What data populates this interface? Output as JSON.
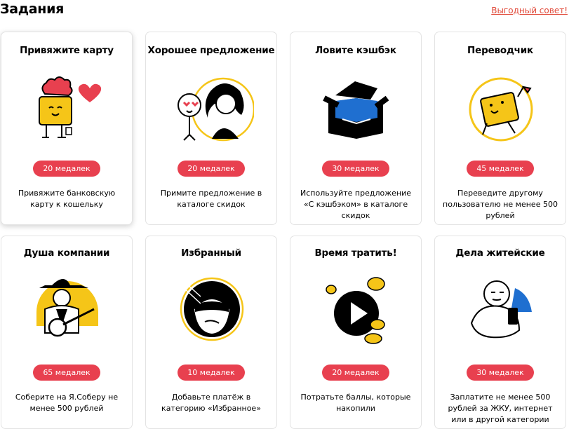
{
  "header": {
    "title": "Задания",
    "tip_link": "Выгодный совет!"
  },
  "colors": {
    "accent": "#e8404f",
    "yellow": "#f5c518",
    "link": "#e14a3a",
    "blue": "#1f6fd0"
  },
  "tasks": [
    {
      "title": "Привяжите карту",
      "badge": "20 медалек",
      "desc": "Привяжите банковскую карту к кошельку",
      "icon": "card-character-icon"
    },
    {
      "title": "Хорошее предложение",
      "badge": "20 медалек",
      "desc": "Примите предложение в каталоге скидок",
      "icon": "couple-icon"
    },
    {
      "title": "Ловите кэшбэк",
      "badge": "30 медалек",
      "desc": "Используйте предложение «С кэшбэком» в каталоге скидок",
      "icon": "open-box-icon"
    },
    {
      "title": "Переводчик",
      "badge": "45 медалек",
      "desc": "Переведите другому пользователю не менее 500 рублей",
      "icon": "running-card-icon"
    },
    {
      "title": "Душа компании",
      "badge": "65 медалек",
      "desc": "Соберите на Я.Соберу не менее 500 рублей",
      "icon": "guitarist-icon"
    },
    {
      "title": "Избранный",
      "badge": "10 медалек",
      "desc": "Добавьте платёж в категорию «Избранное»",
      "icon": "masked-face-icon"
    },
    {
      "title": "Время тратить!",
      "badge": "20 медалек",
      "desc": "Потратьте баллы, которые накопили",
      "icon": "play-coins-icon"
    },
    {
      "title": "Дела житейские",
      "badge": "30 медалек",
      "desc": "Заплатите не менее 500 рублей за ЖКУ, интернет или в другой категории",
      "icon": "person-phone-icon"
    }
  ]
}
